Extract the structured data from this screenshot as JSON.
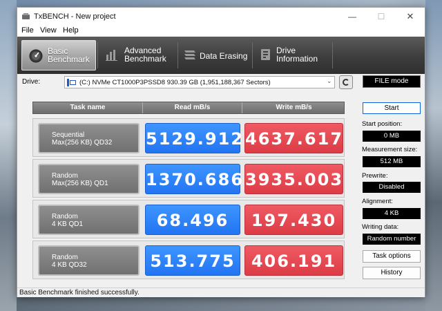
{
  "window": {
    "title": "TxBENCH - New project"
  },
  "menu": {
    "items": [
      "File",
      "View",
      "Help"
    ]
  },
  "tabs": [
    {
      "label": "Basic\nBenchmark",
      "icon": "gauge-icon",
      "active": true
    },
    {
      "label": "Advanced\nBenchmark",
      "icon": "bar-chart-icon",
      "active": false
    },
    {
      "label": "Data Erasing",
      "icon": "stack-erase-icon",
      "active": false
    },
    {
      "label": "Drive\nInformation",
      "icon": "drive-info-icon",
      "active": false
    }
  ],
  "drive": {
    "label": "Drive:",
    "selected": "(C:) NVMe CT1000P3PSSD8  930.39 GB (1,951,188,367 Sectors)",
    "mode": "FILE mode"
  },
  "results": {
    "headers": {
      "task": "Task name",
      "read": "Read mB/s",
      "write": "Write mB/s"
    },
    "rows": [
      {
        "task": "Sequential\nMax(256 KB) QD32",
        "read": "5129.912",
        "write": "4637.617"
      },
      {
        "task": "Random\nMax(256 KB) QD1",
        "read": "1370.686",
        "write": "3935.003"
      },
      {
        "task": "Random\n4 KB QD1",
        "read": "68.496",
        "write": "197.430"
      },
      {
        "task": "Random\n4 KB QD32",
        "read": "513.775",
        "write": "406.191"
      }
    ]
  },
  "settings": {
    "start_label": "Start",
    "start_position": {
      "label": "Start position:",
      "value": "0 MB"
    },
    "measurement_size": {
      "label": "Measurement size:",
      "value": "512 MB"
    },
    "prewrite": {
      "label": "Prewrite:",
      "value": "Disabled"
    },
    "alignment": {
      "label": "Alignment:",
      "value": "4 KB"
    },
    "writing_data": {
      "label": "Writing data:",
      "value": "Random number"
    },
    "task_options_label": "Task options",
    "history_label": "History"
  },
  "status": {
    "text": "Basic Benchmark finished successfully."
  },
  "colors": {
    "read": "#2f84fb",
    "write": "#e84a53",
    "toolbar": "#3d3d3d",
    "accent": "#0a64d8"
  }
}
